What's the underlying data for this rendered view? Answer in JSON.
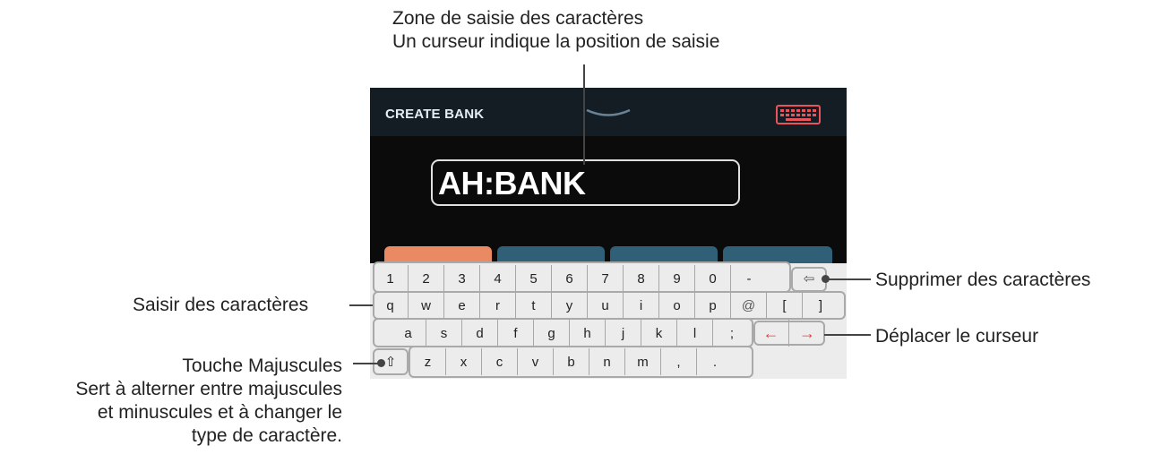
{
  "callouts": {
    "top_line1": "Zone de saisie des caractères",
    "top_line2": "Un curseur indique la position de saisie",
    "saisir": "Saisir des caractères",
    "shift_line1": "Touche Majuscules",
    "shift_line2": "Sert à alterner entre majuscules",
    "shift_line3": "et minuscules et à changer le",
    "shift_line4": "type de caractère.",
    "delete": "Supprimer des caractères",
    "move": "Déplacer le curseur"
  },
  "screen": {
    "title": "CREATE BANK",
    "name_value": "AH:BANK",
    "keyboard_icon": "keyboard-icon",
    "tab_colors": [
      "#e98a63",
      "#2f6077",
      "#2f6077",
      "#2f6077"
    ]
  },
  "keyboard": {
    "row1": [
      "1",
      "2",
      "3",
      "4",
      "5",
      "6",
      "7",
      "8",
      "9",
      "0",
      "-"
    ],
    "backspace": "⇦",
    "row2": [
      "q",
      "w",
      "e",
      "r",
      "t",
      "y",
      "u",
      "i",
      "o",
      "p",
      "@",
      "[",
      "]"
    ],
    "row3": [
      "a",
      "s",
      "d",
      "f",
      "g",
      "h",
      "j",
      "k",
      "l",
      ";"
    ],
    "cursor_left": "←",
    "cursor_right": "→",
    "shift": "⇧",
    "row4": [
      "z",
      "x",
      "c",
      "v",
      "b",
      "n",
      "m",
      ",",
      "."
    ]
  },
  "colors": {
    "arrow": "#e23b3b",
    "keyboard_icon": "#e8545a"
  }
}
